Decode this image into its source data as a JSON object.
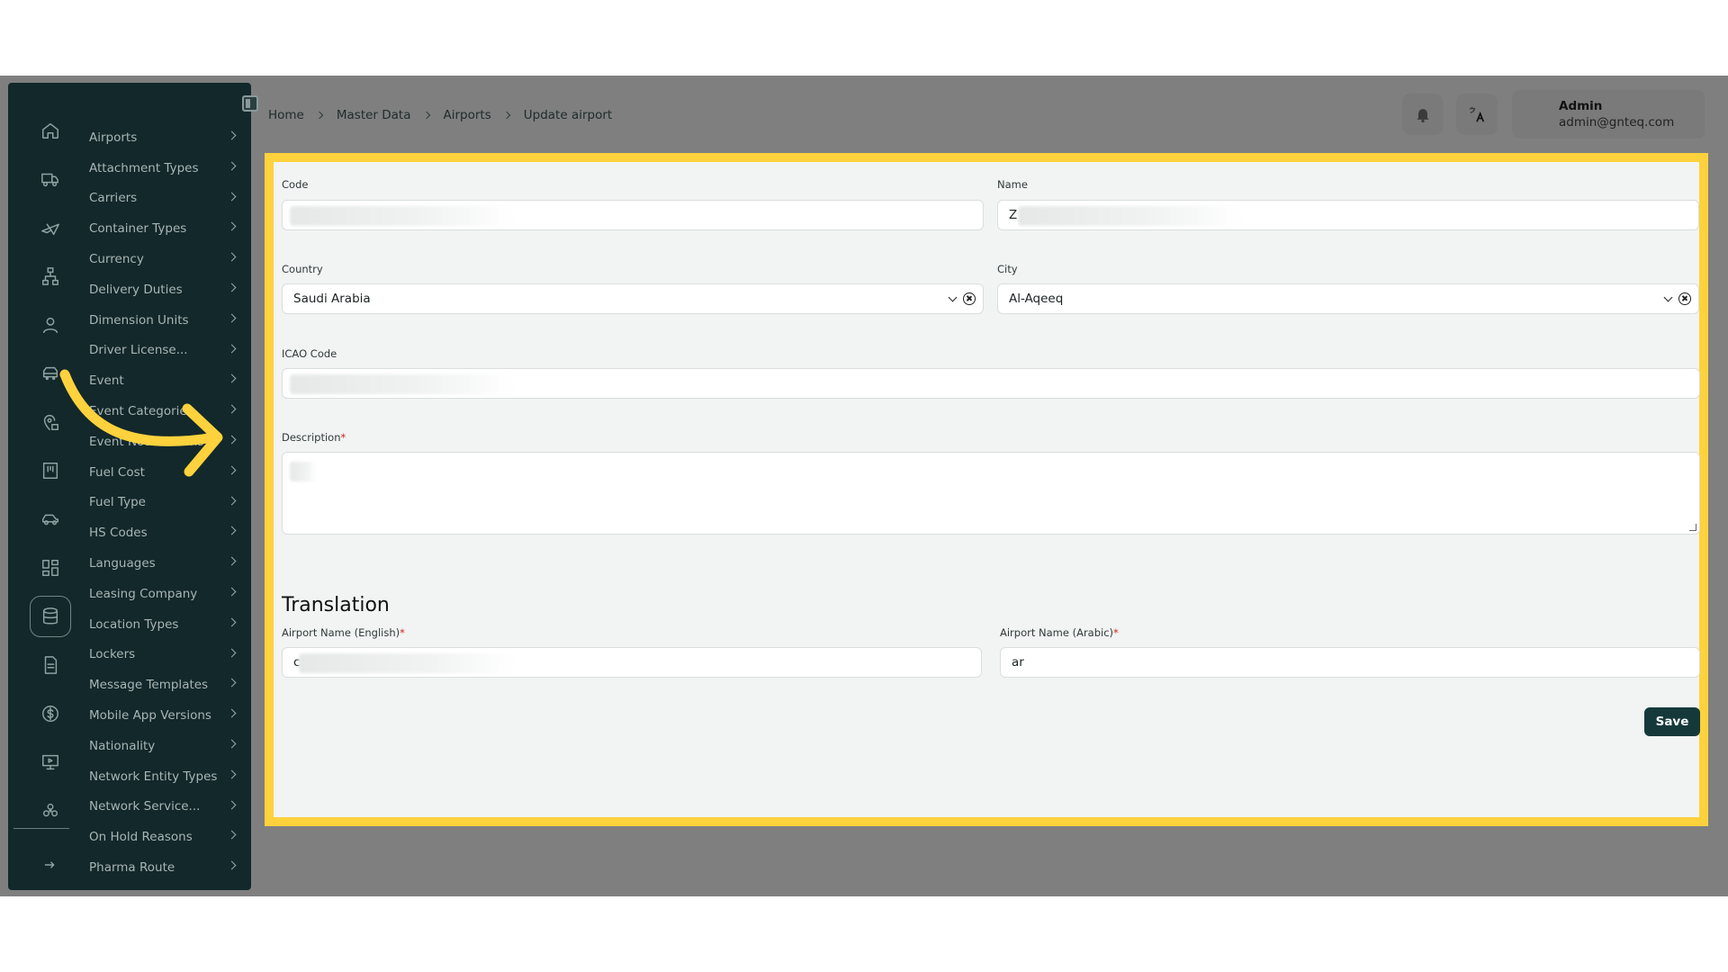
{
  "sidebar": {
    "rail_icons": [
      "home-icon",
      "truck-icon",
      "plane-icon",
      "hierarchy-icon",
      "user-icon",
      "vehicle-bus-icon",
      "location-icon",
      "board-icon",
      "car-icon",
      "grid-icon",
      "database-icon",
      "document-icon",
      "dollar-icon",
      "monitor-icon",
      "network-icon",
      "logout-icon"
    ],
    "items": [
      {
        "label": "Airports"
      },
      {
        "label": "Attachment Types"
      },
      {
        "label": "Carriers"
      },
      {
        "label": "Container Types"
      },
      {
        "label": "Currency"
      },
      {
        "label": "Delivery Duties"
      },
      {
        "label": "Dimension Units"
      },
      {
        "label": "Driver License..."
      },
      {
        "label": "Event"
      },
      {
        "label": "Event Categories"
      },
      {
        "label": "Event Notifications"
      },
      {
        "label": "Fuel Cost"
      },
      {
        "label": "Fuel Type"
      },
      {
        "label": "HS Codes"
      },
      {
        "label": "Languages"
      },
      {
        "label": "Leasing Company"
      },
      {
        "label": "Location Types"
      },
      {
        "label": "Lockers"
      },
      {
        "label": "Message Templates"
      },
      {
        "label": "Mobile App Versions"
      },
      {
        "label": "Nationality"
      },
      {
        "label": "Network Entity Types"
      },
      {
        "label": "Network Service..."
      },
      {
        "label": "On Hold Reasons"
      },
      {
        "label": "Pharma Route"
      }
    ]
  },
  "breadcrumb": [
    "Home",
    "Master Data",
    "Airports",
    "Update airport"
  ],
  "header": {
    "notification_icon": "bell-icon",
    "translate_icon": "translate-icon",
    "user_name": "Admin",
    "user_email": "admin@gnteq.com"
  },
  "form": {
    "code_label": "Code",
    "code_value": "",
    "name_label": "Name",
    "name_value": "Z",
    "country_label": "Country",
    "country_value": "Saudi Arabia",
    "city_label": "City",
    "city_value": "Al-Aqeeq",
    "icao_label": "ICAO Code",
    "icao_value": "",
    "description_label": "Description",
    "required_mark": "*",
    "description_value": ""
  },
  "translation": {
    "title": "Translation",
    "en_label": "Airport Name  (English)",
    "en_value": "c",
    "ar_label": "Airport Name  (Arabic)",
    "ar_value": "ar"
  },
  "actions": {
    "save_label": "Save"
  },
  "colors": {
    "highlight": "#fdd23d",
    "sidebar_bg": "#13282a",
    "save_bg": "#15393b",
    "overlay": "#7f7f7f"
  }
}
